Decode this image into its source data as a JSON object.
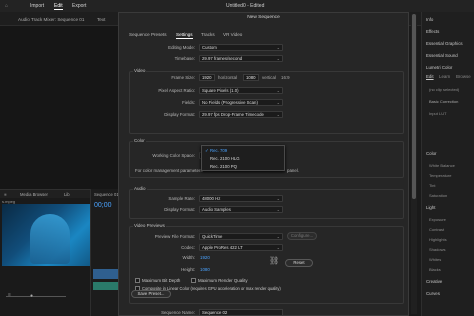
{
  "topbar": {
    "import": "Import",
    "edit": "Edit",
    "export": "Export",
    "doc_title": "Untitled0 - Edited"
  },
  "tabs": {
    "mixer": "Audio Track Mixer: Sequence 01",
    "text": "Text"
  },
  "source": {
    "tab1": "Media Browser",
    "tab2": "Lib",
    "seq": "Sequence 01",
    "timecode": "00;00",
    "filename": "s.mpeg"
  },
  "right_panel": {
    "items": [
      "Info",
      "Effects",
      "Essential Graphics",
      "Essential Sound",
      "Lumetri Color",
      "Edit",
      "(no clip selected)",
      "Basic Correction",
      "Input LUT",
      "Color",
      "White Balance",
      "Temperature",
      "Tint",
      "Saturation",
      "Light",
      "Exposure",
      "Contrast",
      "Highlights",
      "Shadows",
      "Whites",
      "Blacks",
      "Creative",
      "Curves"
    ],
    "tab_edit": "Edit",
    "tab_learn": "Learn",
    "tab_browse": "Browse"
  },
  "dialog": {
    "title": "New Sequence",
    "tabs": [
      "Sequence Presets",
      "Settings",
      "Tracks",
      "VR Video"
    ],
    "editing_mode_label": "Editing Mode:",
    "editing_mode": "Custom",
    "timebase_label": "Timebase:",
    "timebase": "29.97 frames/second",
    "video_section": "Video",
    "frame_size_label": "Frame Size:",
    "frame_w": "1920",
    "horizontal": "horizontal",
    "frame_h": "1080",
    "vertical": "vertical",
    "aspect": "16:9",
    "pixel_aspect_label": "Pixel Aspect Ratio:",
    "pixel_aspect": "Square Pixels (1.0)",
    "fields_label": "Fields:",
    "fields": "No Fields (Progressive Scan)",
    "display_format_label": "Display Format:",
    "display_format": "29.97 fps Drop-Frame Timecode",
    "color_section": "Color",
    "wcs_label": "Working Color Space:",
    "wcs": "Rec. 709",
    "color_mgmt_label": "For color management parameters",
    "color_mgmt_tail": "panel.",
    "menu_options": [
      "Rec. 709",
      "Rec. 2100 HLG",
      "Rec. 2100 PQ"
    ],
    "menu_checked": "✓",
    "audio_section": "Audio",
    "sample_rate_label": "Sample Rate:",
    "sample_rate": "48000 Hz",
    "audio_display_label": "Display Format:",
    "audio_display": "Audio Samples",
    "previews_section": "Video Previews",
    "preview_format_label": "Preview File Format:",
    "preview_format": "QuickTime",
    "configure": "Configure...",
    "codec_label": "Codec:",
    "codec": "Apple ProRes 422 LT",
    "width_label": "Width:",
    "width": "1920",
    "height_label": "Height:",
    "height": "1080",
    "reset": "Reset",
    "max_bit_depth": "Maximum Bit Depth",
    "max_render_quality": "Maximum Render Quality",
    "linear_color": "Composite in Linear Color (requires GPU acceleration or max render quality)",
    "save_preset": "Save Preset...",
    "sequence_name_label": "Sequence Name:",
    "sequence_name": "Sequence 02"
  }
}
